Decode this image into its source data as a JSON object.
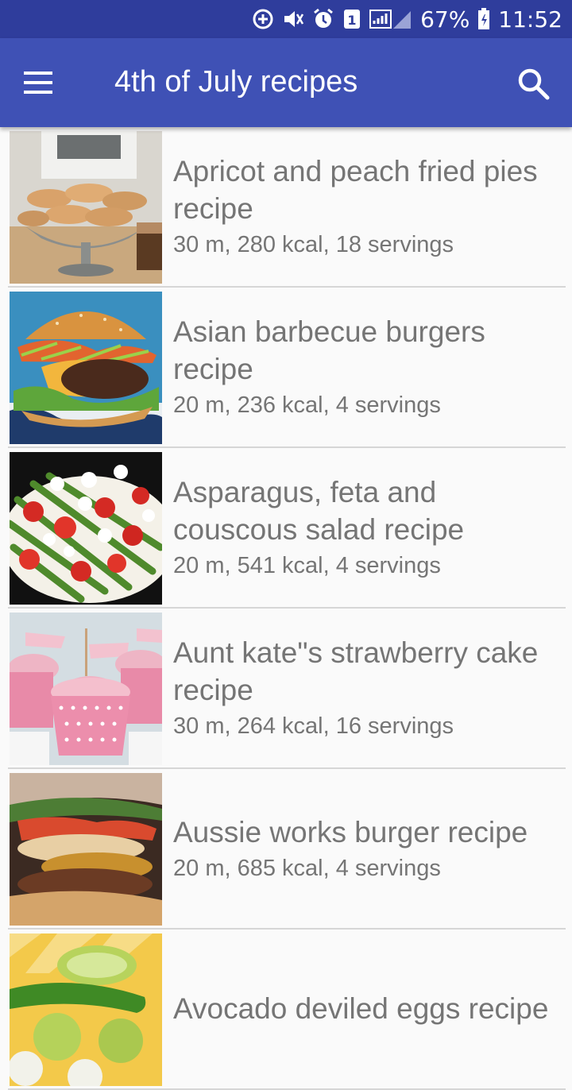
{
  "status_bar": {
    "battery_percent": "67%",
    "time": "11:52",
    "sim_badge": "1",
    "icons": [
      "data-saver-icon",
      "mute-icon",
      "alarm-icon",
      "sim-icon",
      "signal-icon",
      "battery-icon"
    ]
  },
  "app_bar": {
    "title": "4th of July recipes",
    "menu_icon": "hamburger-menu-icon",
    "search_icon": "search-icon",
    "color": "#3f51b5"
  },
  "recipes": [
    {
      "title": "Apricot and peach fried pies recipe",
      "meta": "30 m, 280 kcal, 18 servings",
      "image": "fried-pies-photo"
    },
    {
      "title": "Asian barbecue burgers recipe",
      "meta": "20 m, 236 kcal, 4 servings",
      "image": "burger-photo"
    },
    {
      "title": "Asparagus, feta and couscous salad recipe",
      "meta": "20 m, 541 kcal, 4 servings",
      "image": "salad-photo"
    },
    {
      "title": "Aunt kate\"s strawberry cake recipe",
      "meta": "30 m, 264 kcal, 16 servings",
      "image": "cupcake-photo"
    },
    {
      "title": "Aussie works burger recipe",
      "meta": "20 m, 685 kcal, 4 servings",
      "image": "aussie-burger-photo"
    },
    {
      "title": "Avocado deviled eggs recipe",
      "meta": "",
      "image": "avocado-eggs-photo"
    }
  ]
}
